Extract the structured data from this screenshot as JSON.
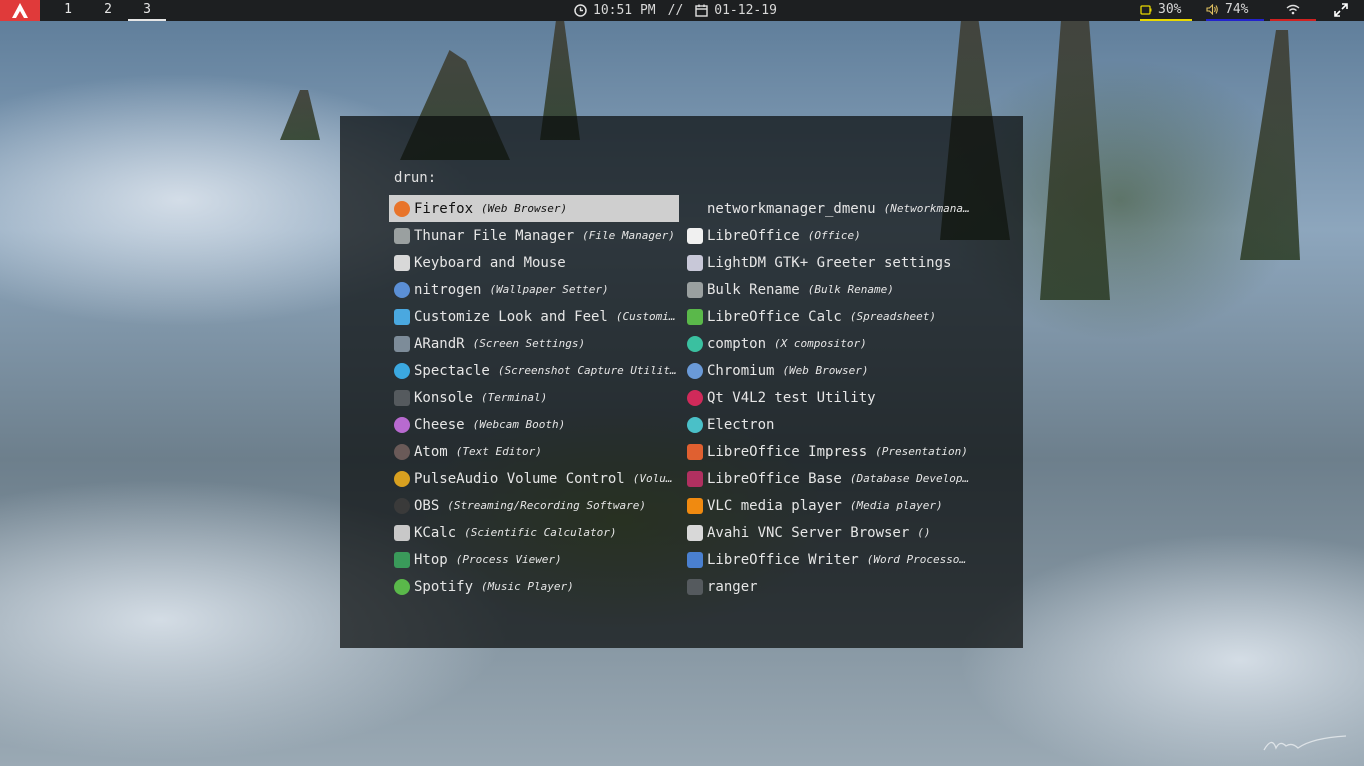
{
  "topbar": {
    "workspaces": [
      {
        "label": "1",
        "active": false
      },
      {
        "label": "2",
        "active": false
      },
      {
        "label": "3",
        "active": true
      }
    ],
    "time": "10:51 PM",
    "separator": "//",
    "date": "01-12-19",
    "battery": "30%",
    "volume": "74%",
    "colors": {
      "bar_bg": "#1d1f21",
      "logo_bg": "#e03a3a",
      "battery_line": "#e8d800",
      "volume_line": "#2222cc",
      "wifi_line": "#d02020"
    }
  },
  "launcher": {
    "prompt": "drun:",
    "left_items": [
      {
        "name": "Firefox",
        "desc": "(Web Browser)",
        "icon": "firefox-icon",
        "color": "#e8742a",
        "selected": true
      },
      {
        "name": "Thunar File Manager",
        "desc": "(File Manager)",
        "icon": "folder-icon",
        "color": "#9aa0a0"
      },
      {
        "name": "Keyboard and Mouse",
        "desc": "",
        "icon": "keyboard-icon",
        "color": "#d8d8d8"
      },
      {
        "name": "nitrogen",
        "desc": "(Wallpaper Setter)",
        "icon": "nitrogen-icon",
        "color": "#5b8fd6"
      },
      {
        "name": "Customize Look and Feel",
        "desc": "(Customize Look and Feel)",
        "icon": "appearance-icon",
        "color": "#4aa8e0"
      },
      {
        "name": "ARandR",
        "desc": "(Screen Settings)",
        "icon": "monitor-icon",
        "color": "#7d8c99"
      },
      {
        "name": "Spectacle",
        "desc": "(Screenshot Capture Utility)",
        "icon": "camera-icon",
        "color": "#3ba8e0"
      },
      {
        "name": "Konsole",
        "desc": "(Terminal)",
        "icon": "terminal-icon",
        "color": "#555a5e"
      },
      {
        "name": "Cheese",
        "desc": "(Webcam Booth)",
        "icon": "webcam-icon",
        "color": "#b86ad0"
      },
      {
        "name": "Atom",
        "desc": "(Text Editor)",
        "icon": "atom-icon",
        "color": "#6a5a58"
      },
      {
        "name": "PulseAudio Volume Control",
        "desc": "(Volume Control)",
        "icon": "speaker-icon",
        "color": "#d8a020"
      },
      {
        "name": "OBS",
        "desc": "(Streaming/Recording Software)",
        "icon": "obs-icon",
        "color": "#3a3a3a"
      },
      {
        "name": "KCalc",
        "desc": "(Scientific Calculator)",
        "icon": "calculator-icon",
        "color": "#c8c8c8"
      },
      {
        "name": "Htop",
        "desc": "(Process Viewer)",
        "icon": "htop-icon",
        "color": "#3a9a5a"
      },
      {
        "name": "Spotify",
        "desc": "(Music Player)",
        "icon": "spotify-icon",
        "color": "#5ab84a"
      }
    ],
    "right_items": [
      {
        "name": "networkmanager_dmenu",
        "desc": "(Networkmanager dmenu)",
        "icon": "",
        "color": ""
      },
      {
        "name": "LibreOffice",
        "desc": "(Office)",
        "icon": "document-icon",
        "color": "#f0f0f0"
      },
      {
        "name": "LightDM GTK+ Greeter settings",
        "desc": "",
        "icon": "settings-panel-icon",
        "color": "#c8c8d8"
      },
      {
        "name": "Bulk Rename",
        "desc": "(Bulk Rename)",
        "icon": "folder-icon",
        "color": "#9aa0a0"
      },
      {
        "name": "LibreOffice Calc",
        "desc": "(Spreadsheet)",
        "icon": "spreadsheet-icon",
        "color": "#5ab84a"
      },
      {
        "name": "compton",
        "desc": "(X compositor)",
        "icon": "gear-icon",
        "color": "#3ac0a0"
      },
      {
        "name": "Chromium",
        "desc": "(Web Browser)",
        "icon": "chromium-icon",
        "color": "#6a9ad8"
      },
      {
        "name": "Qt V4L2 test Utility",
        "desc": "",
        "icon": "qt-icon",
        "color": "#d02a5a"
      },
      {
        "name": "Electron",
        "desc": "",
        "icon": "electron-icon",
        "color": "#4ac0c8"
      },
      {
        "name": "LibreOffice Impress",
        "desc": "(Presentation)",
        "icon": "presentation-icon",
        "color": "#e06030"
      },
      {
        "name": "LibreOffice Base",
        "desc": "(Database Development)",
        "icon": "database-icon",
        "color": "#b03060"
      },
      {
        "name": "VLC media player",
        "desc": "(Media player)",
        "icon": "vlc-icon",
        "color": "#f08a10"
      },
      {
        "name": "Avahi VNC Server Browser",
        "desc": "()",
        "icon": "vnc-icon",
        "color": "#d8d8d8"
      },
      {
        "name": "LibreOffice Writer",
        "desc": "(Word Processor)",
        "icon": "writer-icon",
        "color": "#4a80d0"
      },
      {
        "name": "ranger",
        "desc": "",
        "icon": "terminal-icon",
        "color": "#555a5e"
      }
    ]
  }
}
